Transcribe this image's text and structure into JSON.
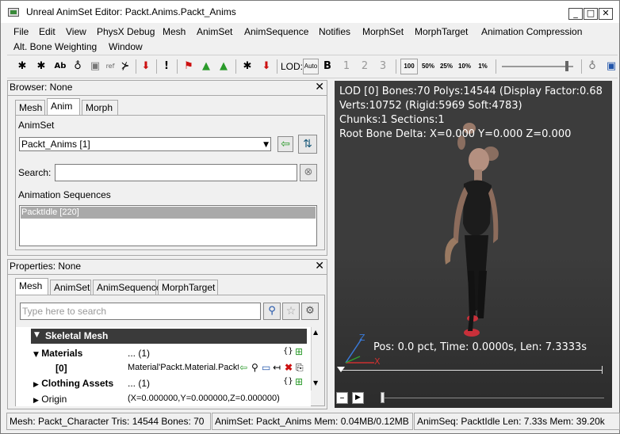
{
  "window": {
    "title": "Unreal AnimSet Editor: Packt.Anims.Packt_Anims",
    "minimize_glyph": "_",
    "maximize_glyph": "□",
    "close_glyph": "✕"
  },
  "menu": [
    "File",
    "Edit",
    "View",
    "PhysX Debug",
    "Mesh",
    "AnimSet",
    "AnimSequence",
    "Notifies",
    "MorphSet",
    "MorphTarget",
    "Animation Compression",
    "Alt. Bone Weighting",
    "Window"
  ],
  "toolbar": {
    "lod_label": "LOD:",
    "lod_auto": "Auto",
    "lod_base": "B",
    "lod_1": "1",
    "lod_2": "2",
    "lod_3": "3",
    "rate_100": "100",
    "rate_50": "50%",
    "rate_25": "25%",
    "rate_10": "10%",
    "rate_1": "1%",
    "ab_label": "Ab",
    "ref_label": "ref",
    "play_speed_level": 0.93
  },
  "browser": {
    "header": "Browser: None",
    "close_glyph": "✕",
    "tabs": [
      "Mesh",
      "Anim",
      "Morph"
    ],
    "active_tab": "Anim",
    "animset_label": "AnimSet",
    "animset_value": "Packt_Anims [1]",
    "search_label": "Search:",
    "search_value": "",
    "sequences_label": "Animation Sequences",
    "sequences": [
      "PacktIdle [220]"
    ]
  },
  "properties": {
    "header": "Properties: None",
    "close_glyph": "✕",
    "tabs": [
      "Mesh",
      "AnimSet",
      "AnimSequence",
      "MorphTarget"
    ],
    "active_tab": "Mesh",
    "search_placeholder": "Type here to search",
    "category": "Skeletal Mesh",
    "rows": [
      {
        "name": "Materials",
        "value": "... (1)"
      },
      {
        "name": "[0]",
        "value": "Material'Packt.Material.Packt"
      },
      {
        "name": "Clothing Assets",
        "value": "... (1)"
      },
      {
        "name": "Origin",
        "value": "(X=0.000000,Y=0.000000,Z=0.000000)"
      }
    ]
  },
  "viewport": {
    "line1": "LOD [0] Bones:70 Polys:14544 (Display Factor:0.68",
    "line2": "Verts:10752 (Rigid:5969 Soft:4783)",
    "line3": "Chunks:1 Sections:1",
    "line4": "Root Bone Delta: X=0.000 Y=0.000 Z=0.000",
    "playback": "Pos: 0.0 pct, Time: 0.0000s, Len: 7.3333s",
    "axis_x": "X",
    "axis_z": "Z",
    "position_fraction": 0.0
  },
  "timeline": {
    "position_fraction": 0.0
  },
  "status": {
    "mesh": "Mesh: Packt_Character  Tris: 14544  Bones: 70",
    "animset": "AnimSet: Packt_Anims  Mem: 0.04MB/0.12MB",
    "animseq": "AnimSeq: PacktIdle  Len: 7.33s  Mem: 39.20k"
  },
  "colors": {
    "viewport_bg": "#3c3c3c",
    "category_bg": "#3a3a3a",
    "selection": "#a9a9a9",
    "accent_red": "#cc1010",
    "accent_green": "#2a9a2a"
  }
}
